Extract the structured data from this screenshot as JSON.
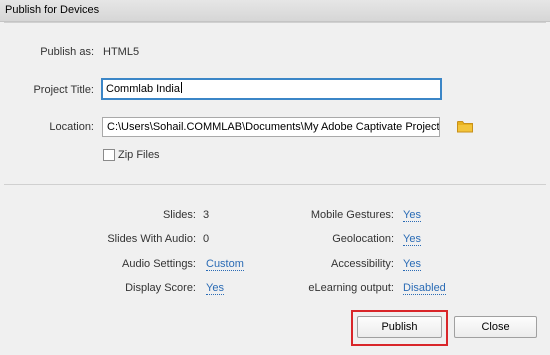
{
  "window": {
    "title": "Publish for Devices"
  },
  "publish_as": {
    "label": "Publish as:",
    "value": "HTML5"
  },
  "project_title": {
    "label": "Project Title:",
    "value": "Commlab India"
  },
  "location": {
    "label": "Location:",
    "value": "C:\\Users\\Sohail.COMMLAB\\Documents\\My Adobe Captivate Projects",
    "icon": "folder-icon"
  },
  "zip_files": {
    "label": "Zip Files",
    "checked": false
  },
  "summary_left": [
    {
      "label": "Slides:",
      "value": "3",
      "link": false
    },
    {
      "label": "Slides With Audio:",
      "value": "0",
      "link": false
    },
    {
      "label": "Audio Settings:",
      "value": "Custom",
      "link": true
    },
    {
      "label": "Display Score:",
      "value": "Yes",
      "link": true
    }
  ],
  "summary_right": [
    {
      "label": "Mobile Gestures:",
      "value": "Yes",
      "link": true
    },
    {
      "label": "Geolocation:",
      "value": "Yes",
      "link": true
    },
    {
      "label": "Accessibility:",
      "value": "Yes",
      "link": true
    },
    {
      "label": "eLearning output:",
      "value": "Disabled",
      "link": true
    }
  ],
  "buttons": {
    "publish": "Publish",
    "close": "Close"
  },
  "colors": {
    "link": "#2a6bb5",
    "highlight": "#d9262a",
    "focus": "#3b86c7",
    "folder": "#e8b21e"
  }
}
